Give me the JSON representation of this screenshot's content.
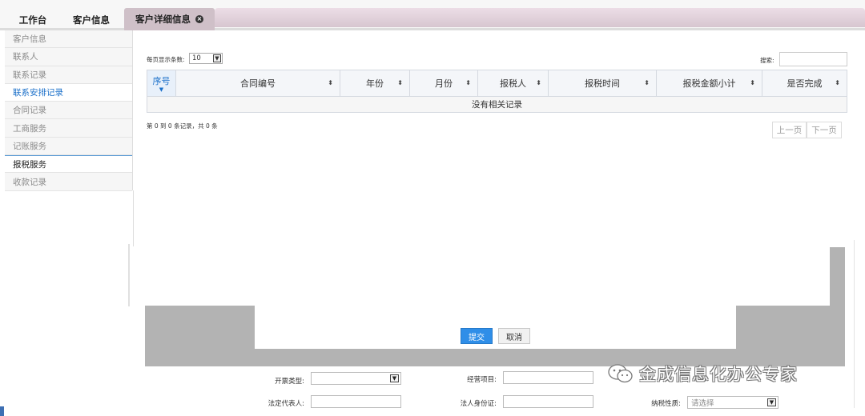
{
  "tabs": [
    {
      "label": "工作台"
    },
    {
      "label": "客户信息"
    },
    {
      "label": "客户详细信息",
      "close": "×"
    }
  ],
  "sidebar": {
    "items": [
      {
        "label": "客户信息"
      },
      {
        "label": "联系人"
      },
      {
        "label": "联系记录"
      },
      {
        "label": "联系安排记录"
      },
      {
        "label": "合同记录"
      },
      {
        "label": "工商服务"
      },
      {
        "label": "记账服务"
      },
      {
        "label": "报税服务"
      },
      {
        "label": "收款记录"
      }
    ]
  },
  "grid": {
    "page_size_label": "每页显示条数:",
    "page_size_value": "10",
    "search_label": "搜索:",
    "columns": [
      "序号",
      "合同编号",
      "年份",
      "月份",
      "报税人",
      "报税时间",
      "报税金额小计",
      "是否完成"
    ],
    "empty_text": "没有相关记录",
    "info_text": "第 0 到 0 条记录，共 0 条",
    "prev_label": "上一页",
    "next_label": "下一页"
  },
  "dialog": {
    "submit_label": "提交",
    "cancel_label": "取消"
  },
  "form": {
    "invoice_type_label": "开票类型:",
    "business_scope_label": "经营项目:",
    "legal_rep_label": "法定代表人:",
    "legal_id_label": "法人身份证:",
    "tax_nature_label": "纳税性质:",
    "tax_nature_placeholder": "请选择"
  },
  "watermark": {
    "text": "金成信息化办公专家"
  },
  "colors": {
    "accent": "#2f8ee8",
    "active_link": "#1a6fc9",
    "overlay_gray": "#b3b3b3"
  }
}
